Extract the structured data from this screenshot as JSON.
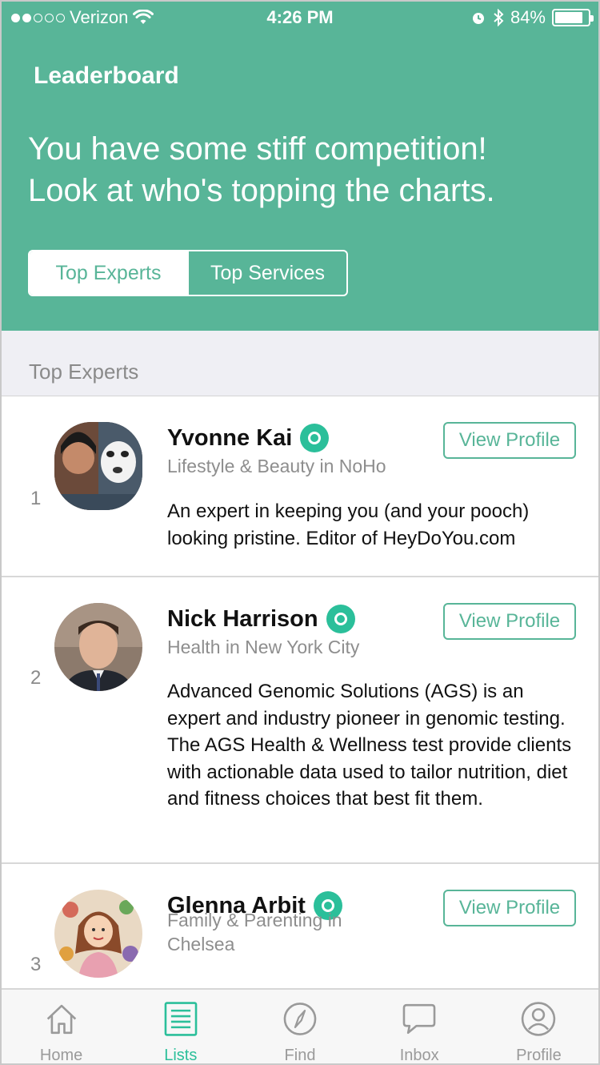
{
  "status_bar": {
    "carrier": "Verizon",
    "time": "4:26 PM",
    "battery": "84%",
    "battery_level": 0.84,
    "signal_bars_filled": 2,
    "signal_bars_total": 5
  },
  "header": {
    "title": "Leaderboard",
    "headline_line1": "You have some stiff competition!",
    "headline_line2": "Look at who's topping the charts."
  },
  "segments": {
    "top_experts": "Top Experts",
    "top_services": "Top Services",
    "selected": "Top Experts"
  },
  "section": {
    "title": "Top Experts"
  },
  "experts": [
    {
      "rank": "1",
      "name": "Yvonne Kai",
      "subtitle": "Lifestyle & Beauty in NoHo",
      "description": "An expert in keeping you (and your pooch) looking pristine. Editor of HeyDoYou.com",
      "button": "View Profile"
    },
    {
      "rank": "2",
      "name": "Nick Harrison",
      "subtitle": "Health in New York City",
      "description": "Advanced Genomic Solutions (AGS) is an expert and industry pioneer in genomic testing. The AGS Health & Wellness test provide clients with actionable data used to tailor nutrition, diet and fitness choices that best fit them.",
      "button": "View Profile"
    },
    {
      "rank": "3",
      "name": "Glenna Arbit",
      "subtitle": "Family & Parenting in Chelsea",
      "description": "",
      "button": "View Profile"
    }
  ],
  "tabs": [
    {
      "label": "Home",
      "icon": "home-icon"
    },
    {
      "label": "Lists",
      "icon": "list-icon"
    },
    {
      "label": "Find",
      "icon": "compass-icon"
    },
    {
      "label": "Inbox",
      "icon": "chat-bubble-icon"
    },
    {
      "label": "Profile",
      "icon": "user-circle-icon"
    }
  ],
  "active_tab": "Lists",
  "colors": {
    "brand": "#58b598",
    "accent": "#2bbf9a",
    "section_bg": "#efeff4",
    "muted_text": "#8a8a8a"
  }
}
